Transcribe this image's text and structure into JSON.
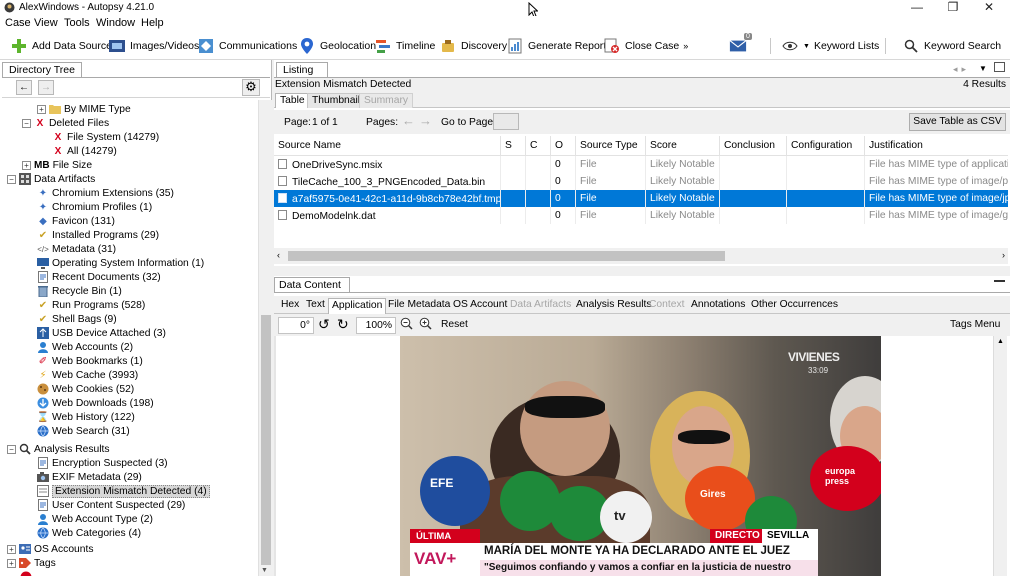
{
  "window": {
    "title": "AlexWindows - Autopsy 4.21.0"
  },
  "menu": [
    "Case",
    "View",
    "Tools",
    "Window",
    "Help"
  ],
  "toolbar": {
    "add_data_source": "Add Data Source",
    "images_videos": "Images/Videos",
    "communications": "Communications",
    "geolocation": "Geolocation",
    "timeline": "Timeline",
    "discovery": "Discovery",
    "generate_report": "Generate Report",
    "close_case": "Close Case",
    "keyword_lists": "Keyword Lists",
    "keyword_search": "Keyword Search",
    "mail_badge": "0"
  },
  "left": {
    "tab": "Directory Tree",
    "tree": [
      {
        "label": "By MIME Type",
        "icon": "folder-icon"
      },
      {
        "label": "Deleted Files",
        "icon": "deleted-files-icon"
      },
      {
        "label": "File System (14279)",
        "icon": "deleted-file-icon"
      },
      {
        "label": "All (14279)",
        "icon": "deleted-file-icon"
      },
      {
        "label": "File Size",
        "icon": "mb-icon",
        "prefix": "MB"
      },
      {
        "label": "Data Artifacts",
        "icon": "data-artifacts-icon"
      },
      {
        "label": "Chromium Extensions (35)",
        "icon": "puzzle-icon"
      },
      {
        "label": "Chromium Profiles (1)",
        "icon": "puzzle-icon"
      },
      {
        "label": "Favicon (131)",
        "icon": "favicon-icon"
      },
      {
        "label": "Installed Programs (29)",
        "icon": "programs-icon"
      },
      {
        "label": "Metadata (31)",
        "icon": "code-icon"
      },
      {
        "label": "Operating System Information (1)",
        "icon": "computer-icon"
      },
      {
        "label": "Recent Documents (32)",
        "icon": "document-icon"
      },
      {
        "label": "Recycle Bin (1)",
        "icon": "recycle-icon"
      },
      {
        "label": "Run Programs (528)",
        "icon": "programs-icon"
      },
      {
        "label": "Shell Bags (9)",
        "icon": "bag-icon"
      },
      {
        "label": "USB Device Attached (3)",
        "icon": "usb-icon"
      },
      {
        "label": "Web Accounts (2)",
        "icon": "account-icon"
      },
      {
        "label": "Web Bookmarks (1)",
        "icon": "bookmark-icon"
      },
      {
        "label": "Web Cache (3993)",
        "icon": "cache-icon"
      },
      {
        "label": "Web Cookies (52)",
        "icon": "cookie-icon"
      },
      {
        "label": "Web Downloads (198)",
        "icon": "download-icon"
      },
      {
        "label": "Web History (122)",
        "icon": "history-icon"
      },
      {
        "label": "Web Search (31)",
        "icon": "web-search-icon"
      },
      {
        "label": "Analysis Results",
        "icon": "analysis-icon"
      },
      {
        "label": "Encryption Suspected (3)",
        "icon": "document-icon"
      },
      {
        "label": "EXIF Metadata (29)",
        "icon": "camera-icon"
      },
      {
        "label": "Extension Mismatch Detected (4)",
        "icon": "mismatch-icon"
      },
      {
        "label": "User Content Suspected (29)",
        "icon": "document-icon"
      },
      {
        "label": "Web Account Type (2)",
        "icon": "account-icon"
      },
      {
        "label": "Web Categories (4)",
        "icon": "web-search-icon"
      },
      {
        "label": "OS Accounts",
        "icon": "os-accounts-icon"
      },
      {
        "label": "Tags",
        "icon": "tags-icon"
      }
    ]
  },
  "listing": {
    "tab": "Listing",
    "title": "Extension Mismatch Detected",
    "results": "4  Results",
    "subtabs": [
      "Table",
      "Thumbnail",
      "Summary"
    ],
    "page_label": "Page:",
    "page_value": "1 of 1",
    "pages_label": "Pages:",
    "goto_label": "Go to Page:",
    "save_button": "Save Table as CSV",
    "columns": [
      "Source Name",
      "S",
      "C",
      "O",
      "Source Type",
      "Score",
      "Conclusion",
      "Configuration",
      "Justification"
    ],
    "rows": [
      {
        "name": "OneDriveSync.msix",
        "o": "0",
        "type": "File",
        "score": "Likely Notable",
        "justification": "File has MIME type of application"
      },
      {
        "name": "TileCache_100_3_PNGEncoded_Data.bin",
        "o": "0",
        "type": "File",
        "score": "Likely Notable",
        "justification": "File has MIME type of image/png"
      },
      {
        "name": "a7af5975-0e41-42c1-a11d-9b8cb78e42bf.tmp",
        "o": "0",
        "type": "File",
        "score": "Likely Notable",
        "justification": "File has MIME type of image/jpeg"
      },
      {
        "name": "DemoModelnk.dat",
        "o": "0",
        "type": "File",
        "score": "Likely Notable",
        "justification": "File has MIME type of image/gif"
      }
    ]
  },
  "content": {
    "tab": "Data Content",
    "tabs": [
      "Hex",
      "Text",
      "Application",
      "File Metadata",
      "OS Account",
      "Data Artifacts",
      "Analysis Results",
      "Context",
      "Annotations",
      "Other Occurrences"
    ],
    "rotation": "0°",
    "zoom": "100%",
    "reset": "Reset",
    "tags_menu": "Tags Menu"
  },
  "photo": {
    "channel_logo": "VIVIENES",
    "timecode": "33:09",
    "breaking": "ÚLTIMA HORA",
    "live": "DIRECTO",
    "location": "SEVILLA",
    "headline": "MARÍA DEL MONTE YA HA DECLARADO ANTE EL JUEZ",
    "quote": "\"Seguimos confiando y vamos a confiar en la justicia de nuestro",
    "mic_ef": "EFE",
    "mic_gires": "Gires",
    "mic_europa": "europa press",
    "mic_tv": "tv",
    "program_logo": "VAV+"
  },
  "colors": {
    "selection": "#0078d7",
    "accent_red": "#d3001c",
    "banner_magenta": "#c2185b"
  }
}
